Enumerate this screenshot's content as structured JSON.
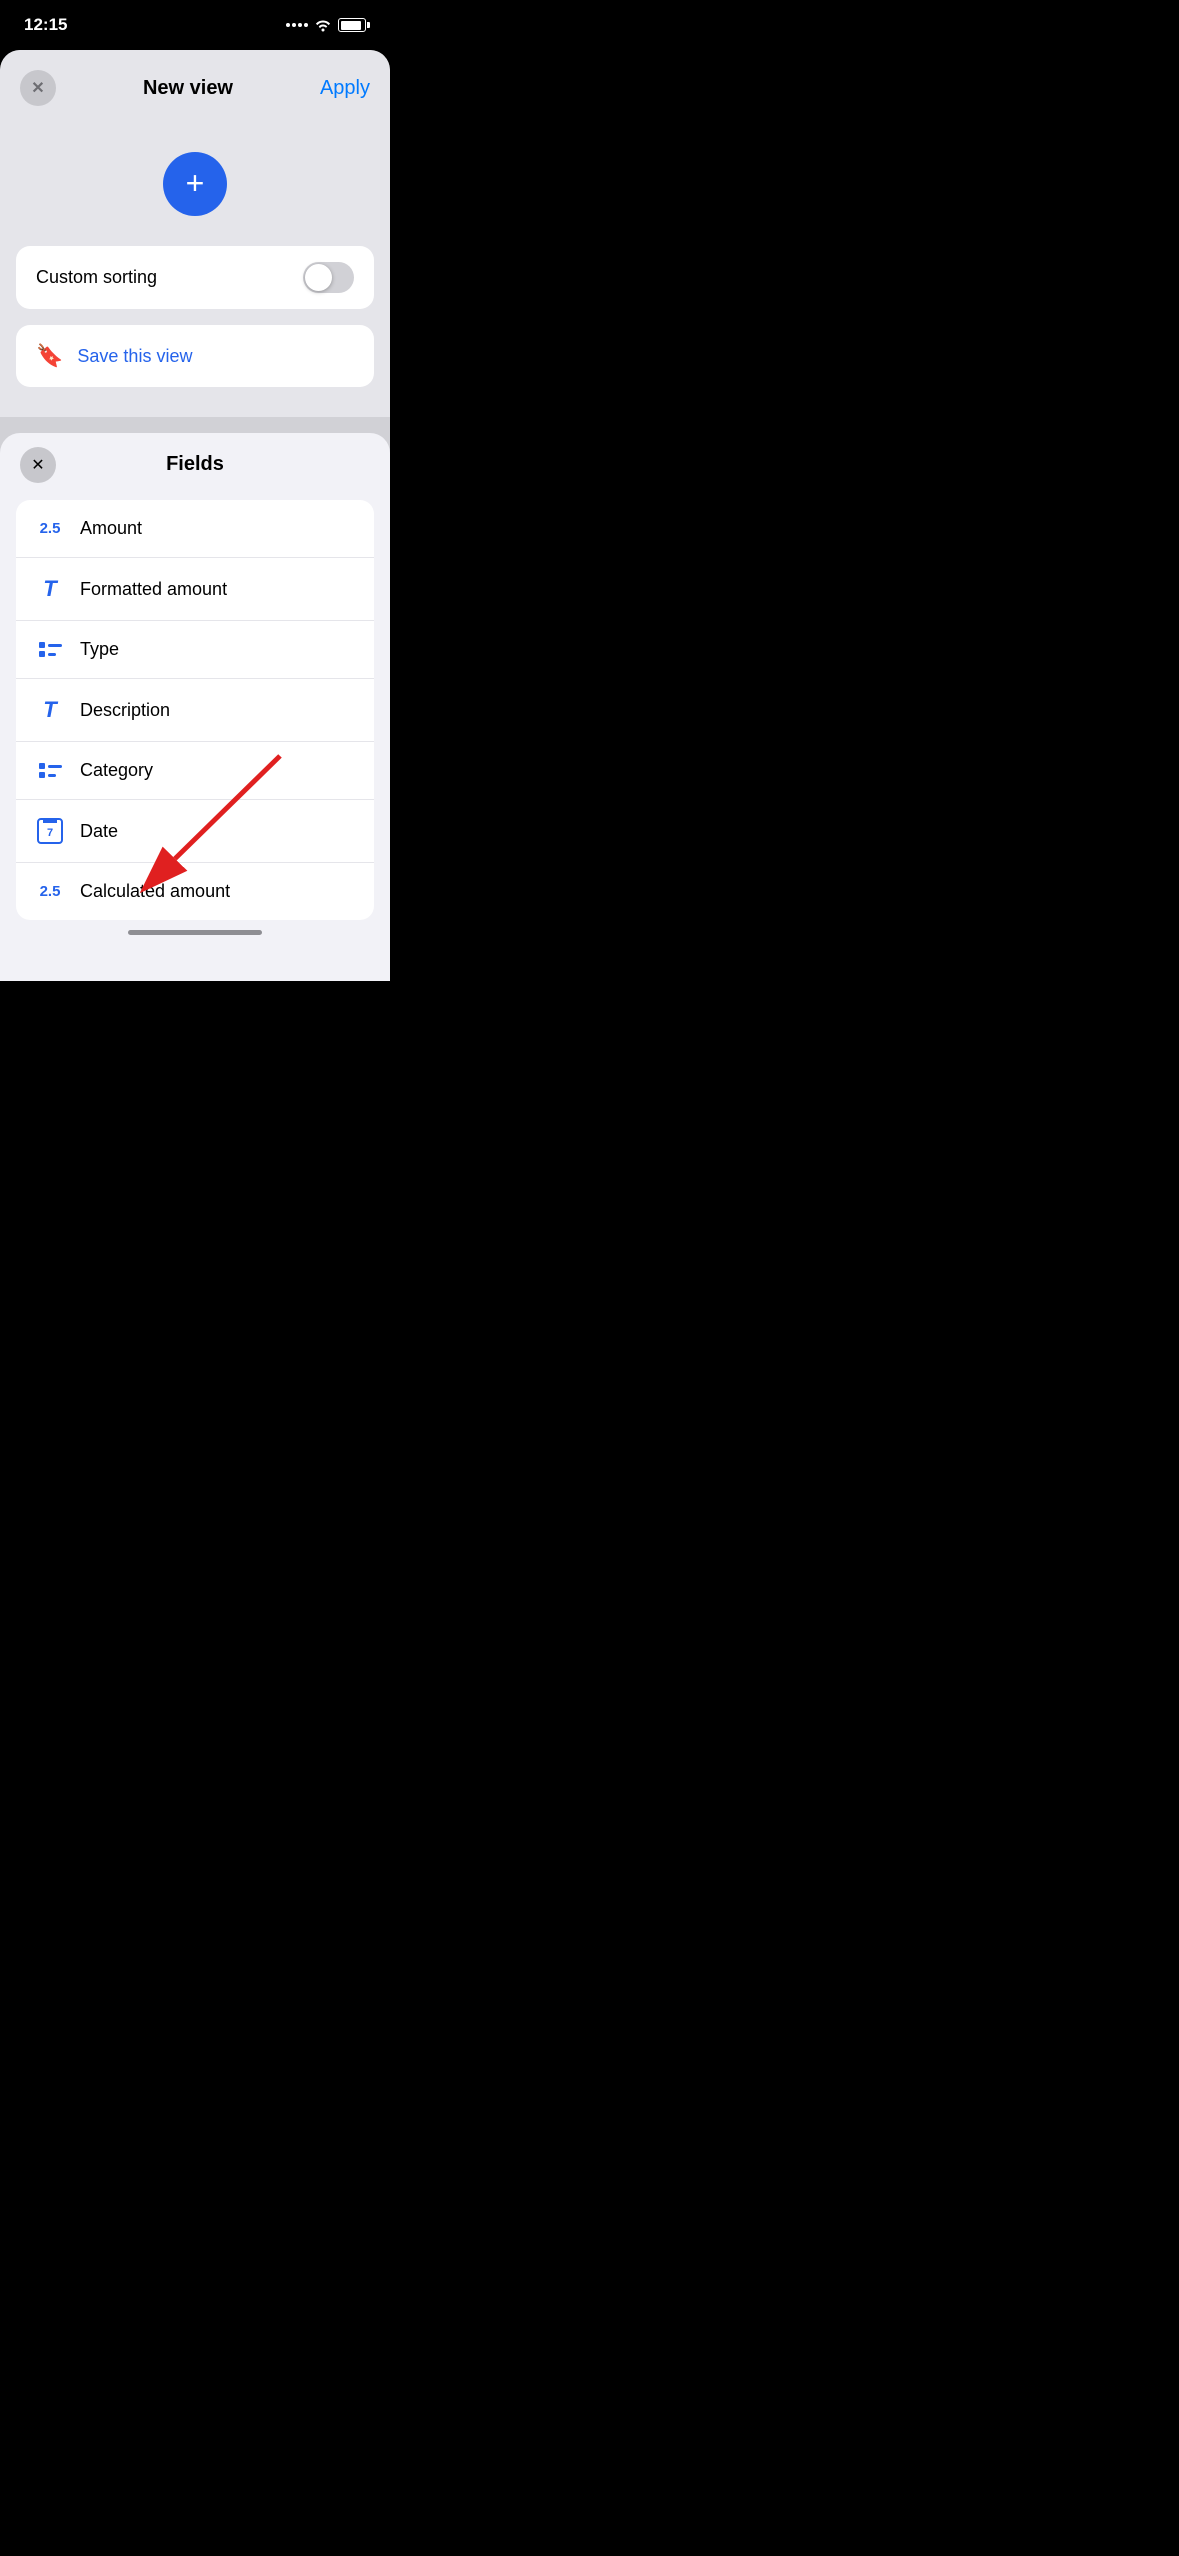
{
  "statusBar": {
    "time": "12:15"
  },
  "newViewPanel": {
    "title": "New view",
    "applyLabel": "Apply",
    "closeBtnAriaLabel": "Close"
  },
  "customSorting": {
    "label": "Custom sorting",
    "toggleEnabled": false
  },
  "saveView": {
    "label": "Save this view"
  },
  "fieldsPanel": {
    "title": "Fields",
    "fields": [
      {
        "id": "amount",
        "label": "Amount",
        "iconType": "num",
        "iconText": "2.5"
      },
      {
        "id": "formatted-amount",
        "label": "Formatted amount",
        "iconType": "text",
        "iconText": "T"
      },
      {
        "id": "type",
        "label": "Type",
        "iconType": "list"
      },
      {
        "id": "description",
        "label": "Description",
        "iconType": "text",
        "iconText": "T"
      },
      {
        "id": "category",
        "label": "Category",
        "iconType": "list"
      },
      {
        "id": "date",
        "label": "Date",
        "iconType": "calendar",
        "iconText": "7"
      },
      {
        "id": "calculated-amount",
        "label": "Calculated amount",
        "iconType": "num",
        "iconText": "2.5"
      }
    ]
  },
  "homeIndicator": {}
}
